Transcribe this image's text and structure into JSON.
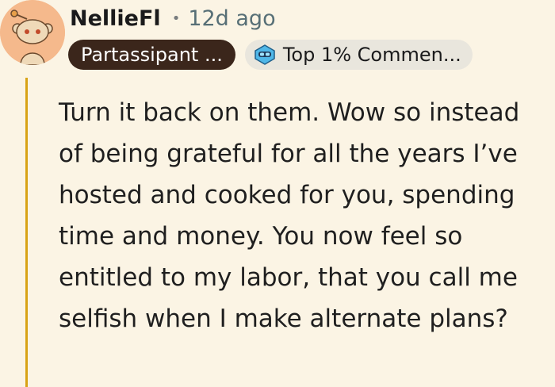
{
  "comment": {
    "author": "NellieFl",
    "separator": "•",
    "timestamp": "12d ago",
    "user_flair": "Partassipant ...",
    "achievement_flair": "Top 1% Commen...",
    "body": "Turn it back on them. Wow so instead of being grateful for all the years I’ve hosted and cooked for you, spending time and money. You now feel so entitled to my labor, that you call me selfish when I make alternate plans?"
  },
  "icons": {
    "avatar": "snoo-avatar",
    "achievement_badge": "top-commenter-badge-icon"
  },
  "colors": {
    "background": "#fbf4e4",
    "avatar_bg": "#f5b98c",
    "flair_bg": "#3b261b",
    "achievement_bg": "#e9e6dd",
    "thread_line": "#d8a316"
  }
}
